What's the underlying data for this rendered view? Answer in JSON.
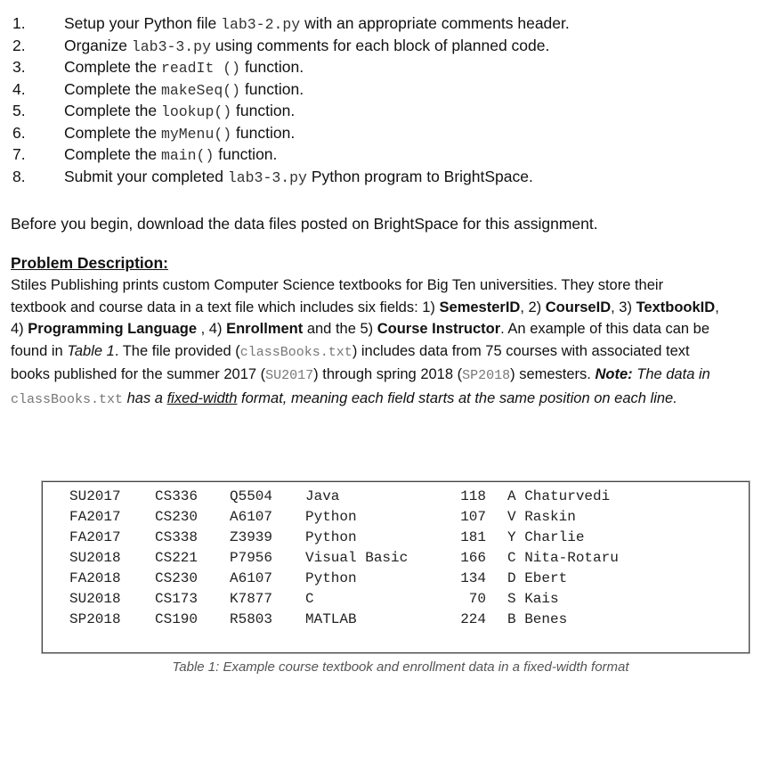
{
  "steps": [
    {
      "num": "1.",
      "before": "Setup your Python file ",
      "code": "lab3-2.py",
      "after": " with an appropriate comments header."
    },
    {
      "num": "2.",
      "before": "Organize ",
      "code": "lab3-3.py",
      "after": " using comments for each block of planned code."
    },
    {
      "num": "3.",
      "before": "Complete the ",
      "code": "readIt ()",
      "after": " function."
    },
    {
      "num": "4.",
      "before": "Complete the ",
      "code": "makeSeq()",
      "after": " function."
    },
    {
      "num": "5.",
      "before": "Complete the ",
      "code": "lookup()",
      "after": " function."
    },
    {
      "num": "6.",
      "before": "Complete the ",
      "code": "myMenu()",
      "after": " function."
    },
    {
      "num": "7.",
      "before": "Complete the ",
      "code": "main()",
      "after": " function."
    },
    {
      "num": "8.",
      "before": "Submit your completed ",
      "code": "lab3-3.py",
      "after": " Python program to BrightSpace."
    }
  ],
  "intro": "Before you begin, download the data files posted on BrightSpace for this assignment.",
  "problem": {
    "heading": "Problem Description:",
    "p1": "Stiles Publishing prints custom Computer Science textbooks for Big Ten universities. They store their textbook and course data in a text file which includes six fields: 1) ",
    "f1": "SemesterID",
    "p2": ", 2) ",
    "f2": "CourseID",
    "p3": ", 3) ",
    "f3": "TextbookID",
    "p4": ", 4) ",
    "f4": "Programming Language",
    "p5": " , 4) ",
    "f5": "Enrollment",
    "p6": " and the 5) ",
    "f6": "Course Instructor",
    "p7": ". An example of this data can be found in ",
    "tableref": "Table 1",
    "p8": ". The file provided (",
    "file1": "classBooks.txt",
    "p9": ") includes data from 75 courses with associated text books published for the summer 2017 (",
    "sem1": "SU2017",
    "p10": ") through spring 2018 (",
    "sem2": "SP2018",
    "p11": ") semesters.  ",
    "note_label": "Note:",
    "note1": " The data in ",
    "file2": "classBooks.txt",
    "note2": " has a ",
    "note_ul": "fixed-width",
    "note3": " format, meaning each field starts at the same position on each line."
  },
  "table": {
    "rows": [
      [
        "SU2017",
        "CS336",
        "Q5504",
        "Java",
        "118",
        "A Chaturvedi"
      ],
      [
        "FA2017",
        "CS230",
        "A6107",
        "Python",
        "107",
        "V Raskin"
      ],
      [
        "FA2017",
        "CS338",
        "Z3939",
        "Python",
        "181",
        "Y Charlie"
      ],
      [
        "SU2018",
        "CS221",
        "P7956",
        "Visual Basic",
        "166",
        "C Nita-Rotaru"
      ],
      [
        "FA2018",
        "CS230",
        "A6107",
        "Python",
        "134",
        "D Ebert"
      ],
      [
        "SU2018",
        "CS173",
        "K7877",
        "C",
        "70",
        "S Kais"
      ],
      [
        "SP2018",
        "CS190",
        "R5803",
        "MATLAB",
        "224",
        "B Benes"
      ]
    ],
    "caption": "Table 1: Example course textbook and enrollment data in a fixed-width format"
  }
}
